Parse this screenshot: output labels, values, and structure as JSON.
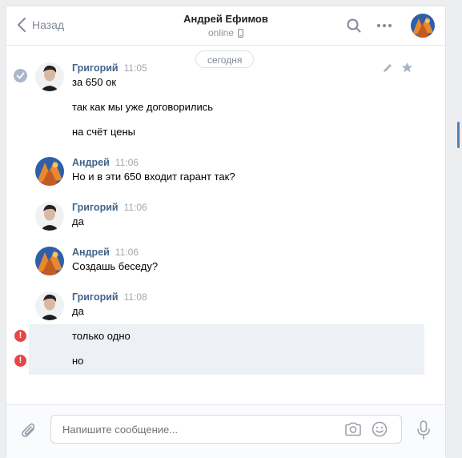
{
  "header": {
    "back_label": "Назад",
    "title": "Андрей Ефимов",
    "status": "online"
  },
  "date_divider": "сегодня",
  "messages": [
    {
      "author": "Григорий",
      "time": "11:05",
      "lines": [
        "за 650 ок",
        "так как мы уже договорились",
        "на счёт цены"
      ]
    },
    {
      "author": "Андрей",
      "time": "11:06",
      "lines": [
        "Но и в эти 650 входит гарант так?"
      ]
    },
    {
      "author": "Григорий",
      "time": "11:06",
      "lines": [
        "да"
      ]
    },
    {
      "author": "Андрей",
      "time": "11:06",
      "lines": [
        "Создашь беседу?"
      ]
    },
    {
      "author": "Григорий",
      "time": "11:08",
      "lines": [
        "да"
      ]
    }
  ],
  "failed_messages": [
    "только одно",
    "но"
  ],
  "failed_marker": "!",
  "composer": {
    "placeholder": "Напишите сообщение..."
  },
  "colors": {
    "accent": "#5181b8",
    "author": "#42648b",
    "error": "#e64646",
    "failed_bg": "#edf0f5"
  }
}
